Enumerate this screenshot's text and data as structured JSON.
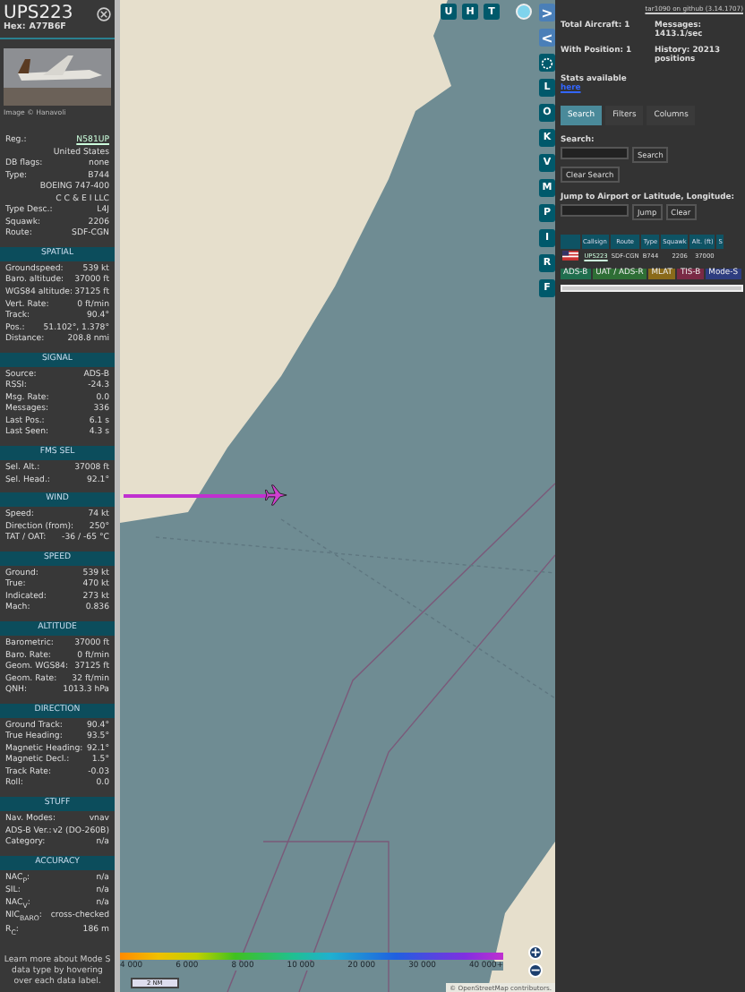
{
  "aircraft": {
    "callsign": "UPS223",
    "hex_label": "Hex:",
    "hex": "A77B6F",
    "photo_credit": "Image © Hanavoli"
  },
  "info_rows": [
    {
      "label": "Reg.:",
      "value": "N581UP",
      "link": true,
      "underlined": true
    },
    {
      "label": "",
      "value": "United States"
    },
    {
      "label": "DB flags:",
      "value": "none"
    },
    {
      "label": "Type:",
      "value": "B744"
    },
    {
      "label": "",
      "value": "BOEING 747-400"
    },
    {
      "label": "",
      "value": "C C & E I LLC"
    },
    {
      "label": "Type Desc.:",
      "value": "L4J"
    },
    {
      "label": "Squawk:",
      "value": "2206"
    },
    {
      "label": "Route:",
      "value": "SDF-CGN"
    }
  ],
  "sections": [
    {
      "title": "SPATIAL",
      "rows": [
        {
          "label": "Groundspeed:",
          "value": "539 kt"
        },
        {
          "label": "Baro. altitude:",
          "value": "37000 ft"
        },
        {
          "label": "WGS84 altitude:",
          "value": "37125 ft"
        },
        {
          "label": "Vert. Rate:",
          "value": "0 ft/min"
        },
        {
          "label": "Track:",
          "value": "90.4°"
        },
        {
          "label": "Pos.:",
          "value": "51.102°, 1.378°"
        },
        {
          "label": "Distance:",
          "value": "208.8 nmi"
        }
      ]
    },
    {
      "title": "SIGNAL",
      "rows": [
        {
          "label": "Source:",
          "value": "ADS-B"
        },
        {
          "label": "RSSI:",
          "value": "-24.3"
        },
        {
          "label": "Msg. Rate:",
          "value": "0.0"
        },
        {
          "label": "Messages:",
          "value": "336"
        },
        {
          "label": "Last Pos.:",
          "value": "6.1 s"
        },
        {
          "label": "Last Seen:",
          "value": "4.3 s"
        }
      ]
    },
    {
      "title": "FMS SEL",
      "rows": [
        {
          "label": "Sel. Alt.:",
          "value": "37008 ft"
        },
        {
          "label": "Sel. Head.:",
          "value": "92.1°"
        }
      ]
    },
    {
      "title": "WIND",
      "rows": [
        {
          "label": "Speed:",
          "value": "74 kt"
        },
        {
          "label": "Direction (from):",
          "value": "250°"
        },
        {
          "label": "TAT / OAT:",
          "value": "-36 / -65 °C"
        }
      ]
    },
    {
      "title": "SPEED",
      "rows": [
        {
          "label": "Ground:",
          "value": "539 kt"
        },
        {
          "label": "True:",
          "value": "470 kt"
        },
        {
          "label": "Indicated:",
          "value": "273 kt"
        },
        {
          "label": "Mach:",
          "value": "0.836"
        }
      ]
    },
    {
      "title": "ALTITUDE",
      "rows": [
        {
          "label": "Barometric:",
          "value": "37000 ft"
        },
        {
          "label": "Baro. Rate:",
          "value": "0 ft/min"
        },
        {
          "label": "Geom. WGS84:",
          "value": "37125 ft"
        },
        {
          "label": "Geom. Rate:",
          "value": "32 ft/min"
        },
        {
          "label": "QNH:",
          "value": "1013.3 hPa"
        }
      ]
    },
    {
      "title": "DIRECTION",
      "rows": [
        {
          "label": "Ground Track:",
          "value": "90.4°"
        },
        {
          "label": "True Heading:",
          "value": "93.5°"
        },
        {
          "label": "Magnetic Heading:",
          "value": "92.1°"
        },
        {
          "label": "Magnetic Decl.:",
          "value": "1.5°"
        },
        {
          "label": "Track Rate:",
          "value": "-0.03"
        },
        {
          "label": "Roll:",
          "value": "0.0"
        }
      ]
    },
    {
      "title": "STUFF",
      "rows": [
        {
          "label": "Nav. Modes:",
          "value": "vnav"
        },
        {
          "label": "ADS-B Ver.:",
          "value": "v2 (DO-260B)"
        },
        {
          "label": "Category:",
          "value": "n/a"
        }
      ]
    },
    {
      "title": "ACCURACY",
      "rows": [
        {
          "label": "NAC$_{P}$:",
          "value": "n/a"
        },
        {
          "label": "SIL:",
          "value": "n/a"
        },
        {
          "label": "NAC$_{V}$:",
          "value": "n/a"
        },
        {
          "label": "NIC$_{BARO}$:",
          "value": "cross-checked"
        },
        {
          "label": "R$_{C}$:",
          "value": "186 m"
        }
      ]
    }
  ],
  "learn_more": "Learn more about Mode S data type by hovering over each data label.",
  "map_buttons": [
    "U",
    "H",
    "T"
  ],
  "side_buttons": [
    {
      "kind": "arrow",
      "label": ">"
    },
    {
      "kind": "arrow",
      "label": "<"
    },
    {
      "kind": "gear"
    },
    {
      "kind": "letter",
      "label": "L"
    },
    {
      "kind": "letter",
      "label": "O"
    },
    {
      "kind": "letter",
      "label": "K"
    },
    {
      "kind": "letter",
      "label": "V"
    },
    {
      "kind": "letter",
      "label": "M"
    },
    {
      "kind": "letter",
      "label": "P"
    },
    {
      "kind": "letter",
      "label": "I"
    },
    {
      "kind": "letter",
      "label": "R"
    },
    {
      "kind": "letter",
      "label": "F"
    }
  ],
  "legend": {
    "labels": [
      "4 000",
      "6 000",
      "8 000",
      "10 000",
      "20 000",
      "30 000",
      "40 000+"
    ]
  },
  "scale": "2 NM",
  "zoom_buttons": [
    "+",
    "−"
  ],
  "attribution": "© OpenStreetMap contributors.",
  "panel": {
    "version_link": "tar1090 on github (3.14.1707)",
    "stats": [
      {
        "label": "Total Aircraft:",
        "value": "1"
      },
      {
        "label": "Messages:",
        "value": "1413.1/sec"
      },
      {
        "label": "With Position:",
        "value": "1"
      },
      {
        "label": "History:",
        "value": "20213 positions"
      }
    ],
    "stats_note": "Stats available",
    "stats_link": "here"
  },
  "tabs": [
    {
      "label": "Search",
      "selected": true
    },
    {
      "label": "Filters",
      "selected": false
    },
    {
      "label": "Columns",
      "selected": false
    }
  ],
  "search": {
    "label": "Search:",
    "button": "Search",
    "clear": "Clear Search",
    "jump_label": "Jump to Airport or Latitude, Longitude:",
    "jump": "Jump",
    "jump_clear": "Clear"
  },
  "table": {
    "columns": [
      "Callsign",
      "Route",
      "Type",
      "Squawk",
      "Alt. (ft)",
      "S"
    ],
    "rows": [
      {
        "callsign": "UPS223",
        "route": "SDF-CGN",
        "type": "B744",
        "squawk": "2206",
        "alt": "37000"
      }
    ]
  },
  "sources": [
    {
      "label": "ADS-B",
      "color": "#1f6e4e"
    },
    {
      "label": "UAT / ADS-R",
      "color": "#2e6e35"
    },
    {
      "label": "MLAT",
      "color": "#8a6a1a"
    },
    {
      "label": "TIS-B",
      "color": "#7a2a45"
    },
    {
      "label": "Mode-S",
      "color": "#2e3d80"
    }
  ]
}
